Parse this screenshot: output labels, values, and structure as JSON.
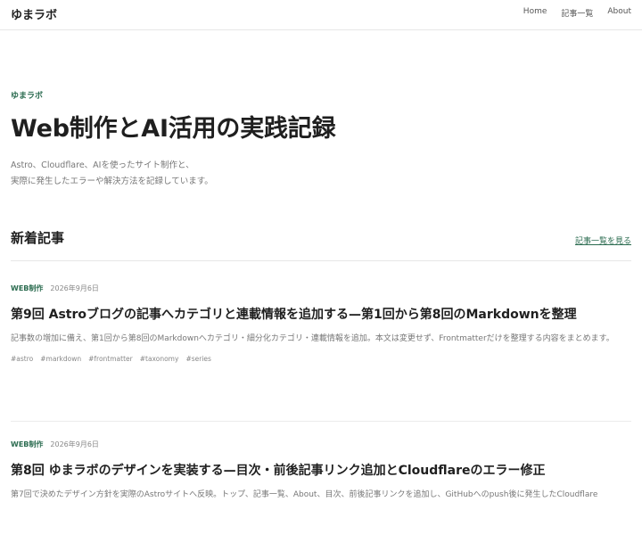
{
  "header": {
    "site_title": "ゆまラボ",
    "nav": [
      {
        "label": "Home"
      },
      {
        "label": "記事一覧"
      },
      {
        "label": "About"
      }
    ]
  },
  "hero": {
    "eyebrow": "ゆまラボ",
    "title": "Web制作とAI活用の実践記録",
    "desc_line1": "Astro、Cloudflare、AIを使ったサイト制作と、",
    "desc_line2": "実際に発生したエラーや解決方法を記録しています。"
  },
  "latest": {
    "heading": "新着記事",
    "all_link": "記事一覧を見る"
  },
  "posts": [
    {
      "category": "WEB制作",
      "date": "2026年9月6日",
      "title": "第9回 Astroブログの記事へカテゴリと連載情報を追加する—第1回から第8回のMarkdownを整理",
      "excerpt": "記事数の増加に備え、第1回から第8回のMarkdownへカテゴリ・細分化カテゴリ・連載情報を追加。本文は変更せず、Frontmatterだけを整理する内容をまとめます。",
      "tags": [
        "#astro",
        "#markdown",
        "#frontmatter",
        "#taxonomy",
        "#series"
      ]
    },
    {
      "category": "WEB制作",
      "date": "2026年9月6日",
      "title": "第8回 ゆまラボのデザインを実装する—目次・前後記事リンク追加とCloudflareのエラー修正",
      "excerpt": "第7回で決めたデザイン方針を実際のAstroサイトへ反映。トップ、記事一覧、About、目次、前後記事リンクを追加し、GitHubへのpush後に発生したCloudflare"
    }
  ]
}
